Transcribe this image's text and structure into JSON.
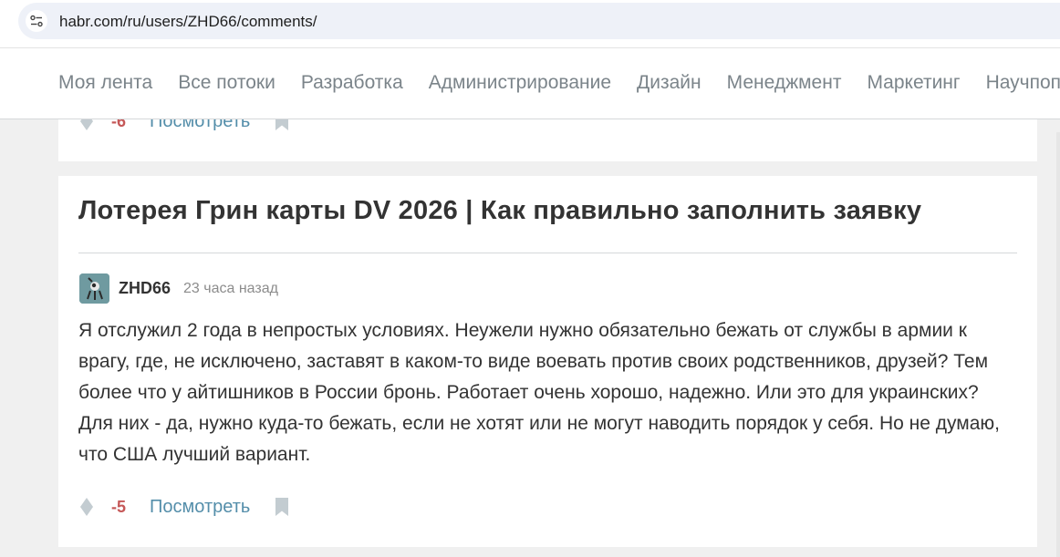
{
  "browser": {
    "url": "habr.com/ru/users/ZHD66/comments/"
  },
  "nav": {
    "items": [
      "Моя лента",
      "Все потоки",
      "Разработка",
      "Администрирование",
      "Дизайн",
      "Менеджмент",
      "Маркетинг",
      "Научпоп"
    ]
  },
  "previous_comment": {
    "score": "-6",
    "view_label": "Посмотреть"
  },
  "comment": {
    "post_title": "Лотерея Грин карты DV 2026 | Как правильно заполнить заявку",
    "author": "ZHD66",
    "time": "23 часа назад",
    "text": "Я отслужил 2 года в непростых условиях. Неужели нужно обязательно бежать от службы в армии к врагу, где, не исключено, заставят в каком-то виде воевать против своих родственников, друзей? Тем более что у айтишников в России бронь. Работает очень хорошо, надежно. Или это для украинских? Для них - да, нужно куда-то бежать, если не хотят или не могут наводить порядок у себя. Но не думаю, что США лучший вариант.",
    "score": "-5",
    "view_label": "Посмотреть"
  },
  "icons": {
    "site_settings": "tune-icon",
    "rating": "diamond-icon",
    "bookmark": "bookmark-icon"
  },
  "colors": {
    "negative_score": "#c55858",
    "link": "#548eaa",
    "nav_text": "#7b848a"
  }
}
